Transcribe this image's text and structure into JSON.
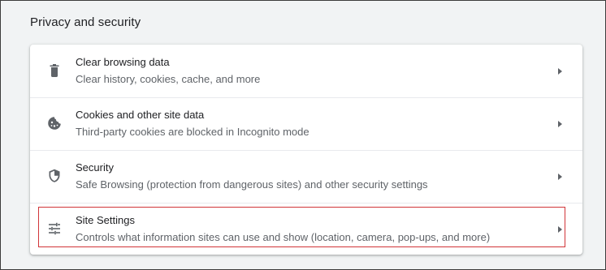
{
  "section": {
    "title": "Privacy and security"
  },
  "items": [
    {
      "label": "Clear browsing data",
      "sublabel": "Clear history, cookies, cache, and more",
      "icon": "trash-icon"
    },
    {
      "label": "Cookies and other site data",
      "sublabel": "Third-party cookies are blocked in Incognito mode",
      "icon": "cookie-icon"
    },
    {
      "label": "Security",
      "sublabel": "Safe Browsing (protection from dangerous sites) and other security settings",
      "icon": "shield-icon"
    },
    {
      "label": "Site Settings",
      "sublabel": "Controls what information sites can use and show (location, camera, pop-ups, and more)",
      "icon": "tune-sliders-icon"
    }
  ],
  "colors": {
    "background": "#f1f3f4",
    "card": "#ffffff",
    "text_primary": "#202124",
    "text_secondary": "#5f6368",
    "icon": "#5f6368",
    "highlight_border": "#d13438"
  }
}
